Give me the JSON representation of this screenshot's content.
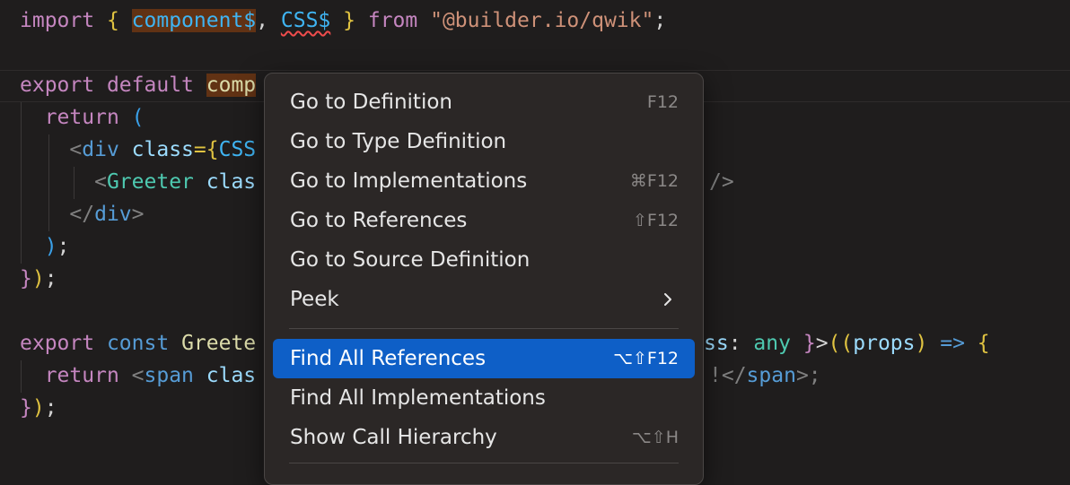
{
  "editor": {
    "lines": [
      [
        "import",
        "{",
        "component$",
        ",",
        "CSS$",
        "}",
        "from",
        "\"@builder.io/qwik\"",
        ";"
      ],
      [
        "export",
        "default",
        "comp"
      ],
      [
        "return",
        "("
      ],
      [
        "<",
        "div",
        "class",
        "={",
        "CSS"
      ],
      [
        "<",
        "Greeter",
        "clas",
        "/>"
      ],
      [
        "</",
        "div",
        ">"
      ],
      [
        ")",
        ";"
      ],
      [
        "}",
        ")",
        ";"
      ],
      [
        "export",
        "const",
        "Greete",
        "ss",
        ":",
        "any",
        "}",
        ">",
        "((",
        "props",
        ")",
        "=>",
        "{"
      ],
      [
        "return",
        "<",
        "span",
        "clas",
        "!</",
        "span",
        ">;"
      ],
      [
        "}",
        ")",
        ";"
      ]
    ]
  },
  "context_menu": {
    "items": [
      {
        "label": "Go to Definition",
        "shortcut": "F12"
      },
      {
        "label": "Go to Type Definition",
        "shortcut": ""
      },
      {
        "label": "Go to Implementations",
        "shortcut": "⌘F12"
      },
      {
        "label": "Go to References",
        "shortcut": "⇧F12"
      },
      {
        "label": "Go to Source Definition",
        "shortcut": ""
      },
      {
        "label": "Peek",
        "submenu": true
      }
    ],
    "items2": [
      {
        "label": "Find All References",
        "shortcut": "⌥⇧F12",
        "active": true
      },
      {
        "label": "Find All Implementations",
        "shortcut": ""
      },
      {
        "label": "Show Call Hierarchy",
        "shortcut": "⌥⇧H"
      }
    ]
  }
}
